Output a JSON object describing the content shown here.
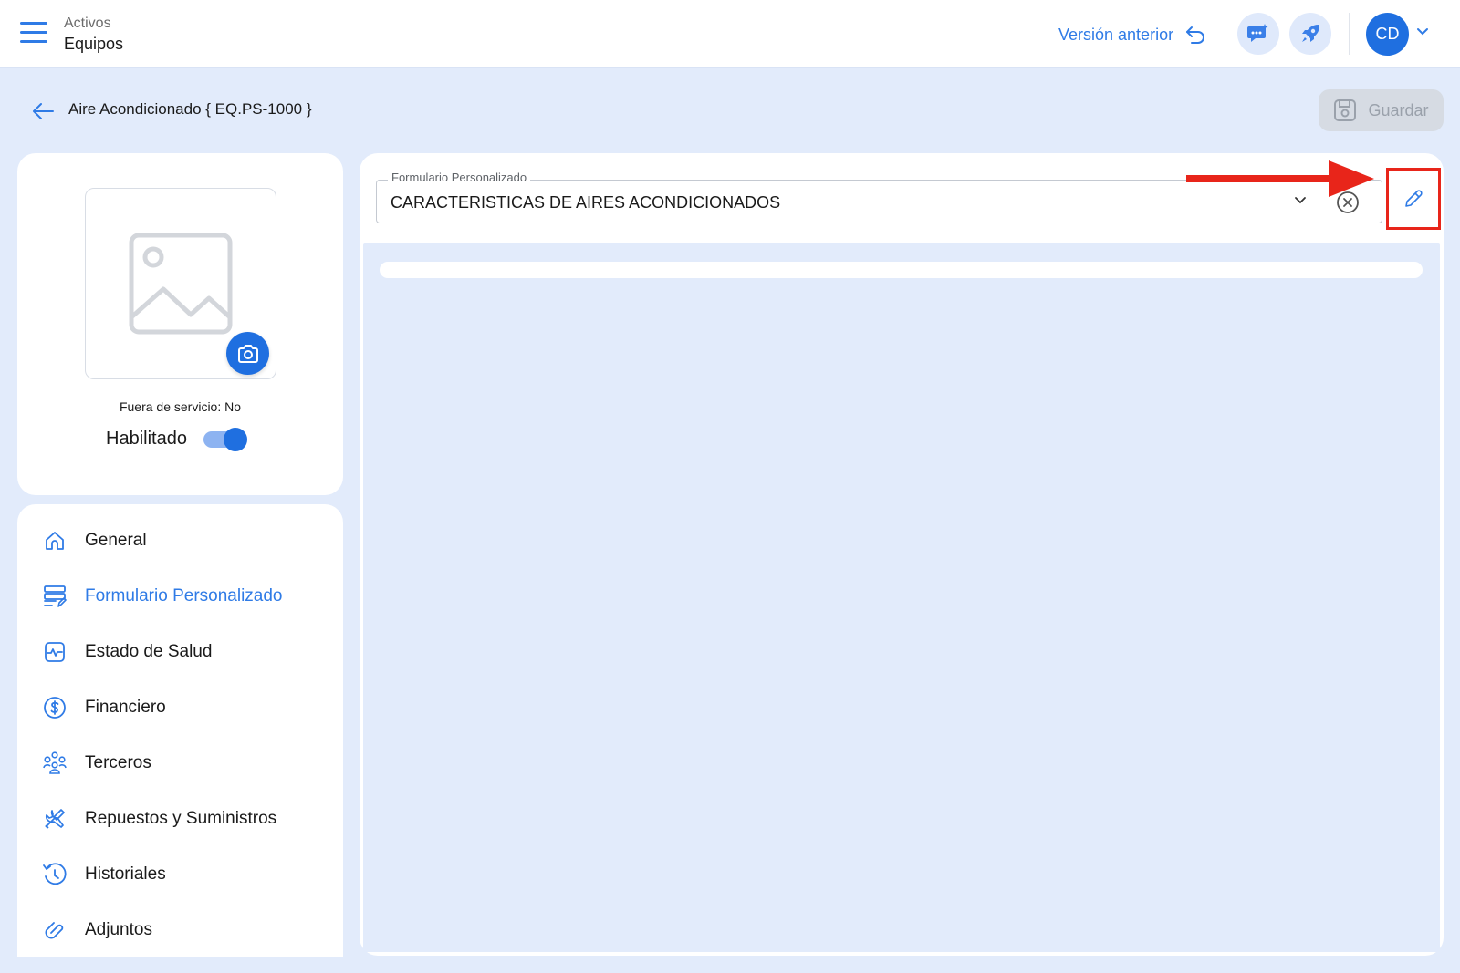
{
  "header": {
    "breadcrumb_parent": "Activos",
    "breadcrumb_current": "Equipos",
    "prev_version_label": "Versión anterior",
    "avatar_initials": "CD"
  },
  "page": {
    "title": "Aire Acondicionado { EQ.PS-1000 }",
    "save_label": "Guardar"
  },
  "asset_card": {
    "status_text": "Fuera de servicio: No",
    "enabled_label": "Habilitado",
    "enabled": true
  },
  "nav": {
    "items": [
      {
        "label": "General",
        "icon": "home-icon",
        "active": false
      },
      {
        "label": "Formulario Personalizado",
        "icon": "form-icon",
        "active": true
      },
      {
        "label": "Estado de Salud",
        "icon": "health-icon",
        "active": false
      },
      {
        "label": "Financiero",
        "icon": "dollar-icon",
        "active": false
      },
      {
        "label": "Terceros",
        "icon": "people-icon",
        "active": false
      },
      {
        "label": "Repuestos y Suministros",
        "icon": "tools-icon",
        "active": false
      },
      {
        "label": "Historiales",
        "icon": "history-icon",
        "active": false
      },
      {
        "label": "Adjuntos",
        "icon": "attachment-icon",
        "active": false
      }
    ]
  },
  "custom_form": {
    "field_label": "Formulario Personalizado",
    "field_value": "CARACTERISTICAS DE AIRES ACONDICIONADOS"
  },
  "colors": {
    "accent": "#1f6fe0",
    "link": "#2f7be6",
    "annotation": "#e8251a",
    "background": "#e2ebfb"
  }
}
